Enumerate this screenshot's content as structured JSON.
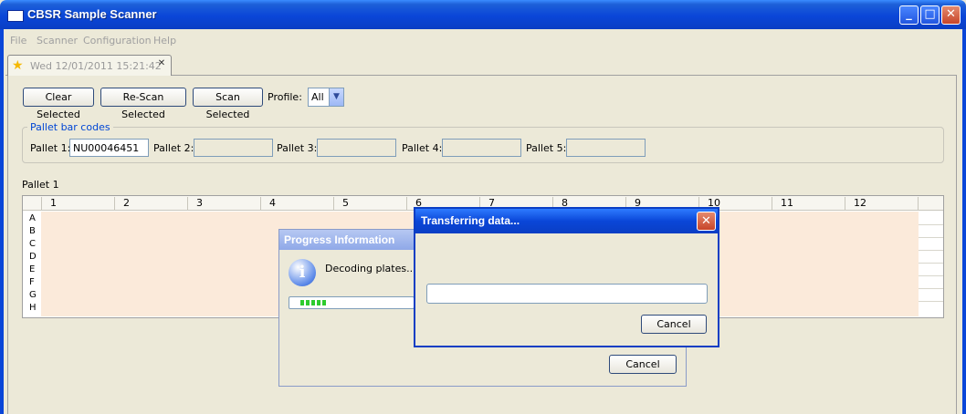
{
  "window": {
    "title": "CBSR Sample Scanner",
    "minimize_glyph": "_",
    "maximize_glyph": "□",
    "close_glyph": "✕"
  },
  "menu": {
    "items": [
      "File",
      "Scanner",
      "Configuration",
      "Help"
    ]
  },
  "tab": {
    "label": "Wed 12/01/2011 15:21:42",
    "icon": "star-icon",
    "close_glyph": "✕"
  },
  "toolbar": {
    "clear_label": "Clear Selected",
    "rescan_label": "Re-Scan Selected",
    "scan_label": "Scan Selected",
    "profile_label": "Profile:",
    "profile_value": "All",
    "profile_arrow": "▼"
  },
  "pallets": {
    "group_title": "Pallet bar codes",
    "fields": [
      {
        "label": "Pallet 1:",
        "value": "NU00046451"
      },
      {
        "label": "Pallet 2:",
        "value": ""
      },
      {
        "label": "Pallet 3:",
        "value": ""
      },
      {
        "label": "Pallet 4:",
        "value": ""
      },
      {
        "label": "Pallet 5:",
        "value": ""
      }
    ]
  },
  "grid": {
    "title": "Pallet 1",
    "columns": [
      "1",
      "2",
      "3",
      "4",
      "5",
      "6",
      "7",
      "8",
      "9",
      "10",
      "11",
      "12"
    ],
    "rows": [
      "A",
      "B",
      "C",
      "D",
      "E",
      "F",
      "G",
      "H"
    ]
  },
  "progress_dialog": {
    "title": "Progress Information",
    "message": "Decoding plates...",
    "icon": "info-icon",
    "icon_glyph": "i",
    "progress_fraction": 0.25,
    "cancel_label": "Cancel"
  },
  "transfer_dialog": {
    "title": "Transferring data...",
    "close_glyph": "✕",
    "progress_fraction": 0.0,
    "cancel_label": "Cancel"
  },
  "colors": {
    "titlebar": "#0A46D8",
    "grid_cell": "#FBEADA",
    "progress": "#2DCB2D",
    "group_title": "#0046D5"
  }
}
